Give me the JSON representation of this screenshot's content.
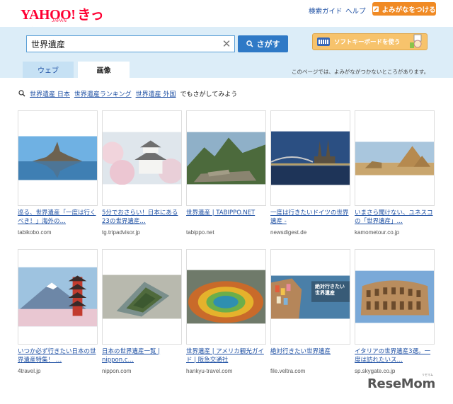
{
  "header": {
    "logo_main": "YAHOO!",
    "logo_kids": "きっず",
    "logo_sub": "JAPAN",
    "help_links": [
      "検索ガイド",
      "ヘルプ"
    ],
    "yomigana_button": "よみがなをつける"
  },
  "search": {
    "query": "世界遺産",
    "submit_label": "さがす",
    "softkb_label": "ソフトキーボードを使う"
  },
  "tabs": [
    {
      "label": "ウェブ",
      "active": false
    },
    {
      "label": "画像",
      "active": true
    }
  ],
  "notice": "このページでは、よみがながつかないところがあります。",
  "related": {
    "links": [
      "世界遺産 日本",
      "世界遺産ランキング",
      "世界遺産 外国"
    ],
    "tail": "でもさがしてみよう"
  },
  "results": [
    {
      "caption": "巡る、世界遺産「一度は行くべき！」海外の…",
      "source": "tabikobo.com",
      "icon": "mont-saint-michel-image"
    },
    {
      "caption": "5分でおさらい！日本にある23の世界遺産…",
      "source": "tg.tripadvisor.jp",
      "icon": "himeji-castle-image"
    },
    {
      "caption": "世界遺産 | TABIPPO.NET",
      "source": "tabippo.net",
      "icon": "machu-picchu-image"
    },
    {
      "caption": "一度は行きたいドイツの世界遺産 -",
      "source": "newsdigest.de",
      "icon": "cologne-cathedral-image"
    },
    {
      "caption": "いまさら聞けない、ユネスコの「世界遺産」…",
      "source": "kamometour.co.jp",
      "icon": "giza-pyramids-image"
    },
    {
      "caption": "いつか必ず行きたい日本の世界遺産特集！ …",
      "source": "4travel.jp",
      "icon": "mount-fuji-pagoda-image"
    },
    {
      "caption": "日本の世界遺産一覧 | nippon.c…",
      "source": "nippon.com",
      "icon": "kofun-aerial-image"
    },
    {
      "caption": "世界遺産 | アメリカ観光ガイド | 阪急交通社",
      "source": "hankyu-travel.com",
      "icon": "yellowstone-spring-image"
    },
    {
      "caption": "絶対行きたい世界遺産",
      "source": "file.veltra.com",
      "icon": "cinque-terre-image"
    },
    {
      "caption": "イタリアの世界遺産3選。一度は訪れたいス…",
      "source": "sp.skygate.co.jp",
      "icon": "colosseum-image"
    }
  ],
  "overlay_text": {
    "cinque_terre": "絶対行きたい世界遺産"
  },
  "watermark": {
    "text": "ReseMom",
    "kana": "リセマム"
  },
  "colors": {
    "brand": "#ff0033",
    "link": "#1d4fa3",
    "band": "#dcedf8",
    "search_button": "#2f79c6",
    "yomigana": "#f08a24"
  }
}
